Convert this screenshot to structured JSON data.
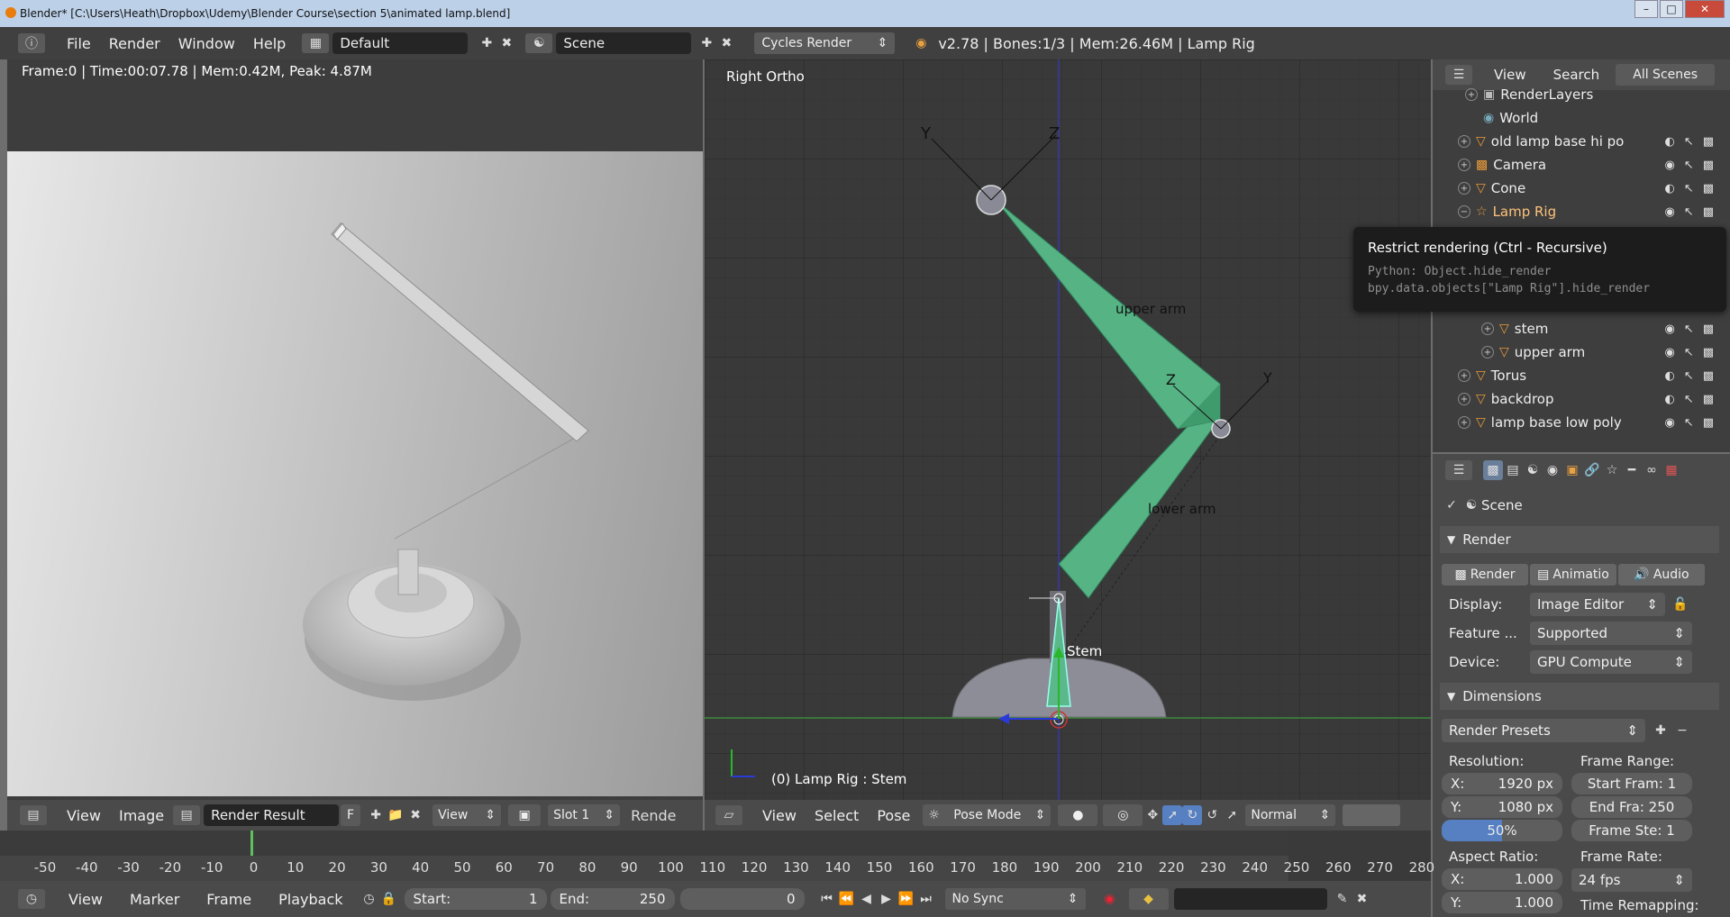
{
  "titlebar": {
    "title": "Blender* [C:\\Users\\Heath\\Dropbox\\Udemy\\Blender Course\\section 5\\animated lamp.blend]"
  },
  "infobar": {
    "menus": [
      "File",
      "Render",
      "Window",
      "Help"
    ],
    "layout": "Default",
    "scene": "Scene",
    "engine": "Cycles Render",
    "stats": "v2.78 | Bones:1/3 | Mem:26.46M | Lamp Rig"
  },
  "image_editor": {
    "status": "Frame:0 | Time:00:07.78 | Mem:0.42M, Peak: 4.87M",
    "header": {
      "view": "View",
      "image": "Image",
      "image_name": "Render Result",
      "f_label": "F",
      "display_view": "View",
      "slot": "Slot 1",
      "render_label": "Rende"
    }
  },
  "viewport": {
    "view_name": "Right Ortho",
    "object_label": "(0) Lamp Rig : Stem",
    "bone_labels": {
      "upper": "upper arm",
      "lower": "lower arm",
      "stem": "Stem"
    },
    "axis_labels": {
      "y": "Y",
      "z": "Z"
    },
    "header": {
      "view": "View",
      "select": "Select",
      "pose": "Pose",
      "mode": "Pose Mode",
      "pivot": "Normal"
    }
  },
  "outliner": {
    "header": {
      "view": "View",
      "search": "Search",
      "scenes": "All Scenes"
    },
    "rows": [
      {
        "label": "RenderLayers",
        "indent": 1
      },
      {
        "label": "World",
        "indent": 1
      },
      {
        "label": "old lamp base hi po",
        "indent": 0
      },
      {
        "label": "Camera",
        "indent": 0
      },
      {
        "label": "Cone",
        "indent": 0
      },
      {
        "label": "Lamp Rig",
        "indent": 0
      },
      {
        "label": "stem",
        "indent": 1
      },
      {
        "label": "upper arm",
        "indent": 1
      },
      {
        "label": "Torus",
        "indent": 0
      },
      {
        "label": "backdrop",
        "indent": 0
      },
      {
        "label": "lamp base low poly",
        "indent": 0
      }
    ]
  },
  "tooltip": {
    "title": "Restrict rendering (Ctrl - Recursive)",
    "line1": "Python: Object.hide_render",
    "line2": "bpy.data.objects[\"Lamp Rig\"].hide_render"
  },
  "properties": {
    "scene": "Scene",
    "render_panel": "Render",
    "render_btn": "Render",
    "anim_btn": "Animatio",
    "audio_btn": "Audio",
    "display_label": "Display:",
    "display_value": "Image Editor",
    "feature_label": "Feature ...",
    "feature_value": "Supported",
    "device_label": "Device:",
    "device_value": "GPU Compute",
    "dimensions_panel": "Dimensions",
    "presets": "Render Presets",
    "resolution_label": "Resolution:",
    "res_x_label": "X:",
    "res_x": "1920 px",
    "res_y_label": "Y:",
    "res_y": "1080 px",
    "res_pct": "50%",
    "res_pct_value": 0.5,
    "frame_range_label": "Frame Range:",
    "start_frame": "Start Fram: 1",
    "end_frame": "End Fra: 250",
    "frame_step": "Frame Ste: 1",
    "aspect_label": "Aspect Ratio:",
    "aspect_x_label": "X:",
    "aspect_x": "1.000",
    "aspect_y_label": "Y:",
    "aspect_y": "1.000",
    "frame_rate_label": "Frame Rate:",
    "frame_rate": "24 fps",
    "time_remap_label": "Time Remapping:"
  },
  "timeline": {
    "ticks": [
      "-50",
      "-40",
      "-30",
      "-20",
      "-10",
      "0",
      "10",
      "20",
      "30",
      "40",
      "50",
      "60",
      "70",
      "80",
      "90",
      "100",
      "110",
      "120",
      "130",
      "140",
      "150",
      "160",
      "170",
      "180",
      "190",
      "200",
      "210",
      "220",
      "230",
      "240",
      "250",
      "260",
      "270",
      "280"
    ],
    "current_frame": 0,
    "header": {
      "view": "View",
      "marker": "Marker",
      "frame": "Frame",
      "playback": "Playback",
      "start_label": "Start:",
      "start": "1",
      "end_label": "End:",
      "end": "250",
      "current": "0",
      "sync": "No Sync"
    }
  }
}
